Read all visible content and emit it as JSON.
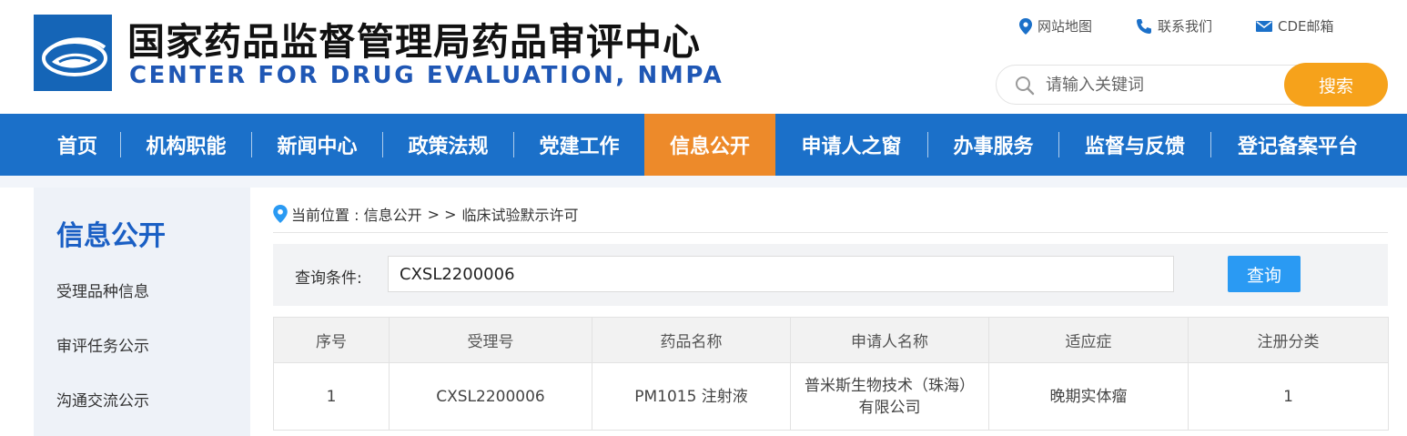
{
  "header": {
    "title_cn": "国家药品监督管理局药品审评中心",
    "title_en": "CENTER FOR DRUG EVALUATION, NMPA",
    "top_links": [
      {
        "label": "网站地图",
        "icon": "location-pin-icon"
      },
      {
        "label": "联系我们",
        "icon": "phone-icon"
      },
      {
        "label": "CDE邮箱",
        "icon": "mail-icon"
      }
    ],
    "search": {
      "placeholder": "请输入关键词",
      "button": "搜索"
    }
  },
  "nav": {
    "items": [
      {
        "label": "首页"
      },
      {
        "label": "机构职能"
      },
      {
        "label": "新闻中心"
      },
      {
        "label": "政策法规"
      },
      {
        "label": "党建工作"
      },
      {
        "label": "信息公开",
        "active": true
      },
      {
        "label": "申请人之窗"
      },
      {
        "label": "办事服务"
      },
      {
        "label": "监督与反馈"
      },
      {
        "label": "登记备案平台"
      }
    ]
  },
  "sidebar": {
    "title": "信息公开",
    "items": [
      {
        "label": "受理品种信息"
      },
      {
        "label": "审评任务公示"
      },
      {
        "label": "沟通交流公示"
      }
    ]
  },
  "breadcrumb": {
    "prefix": "当前位置 : 信息公开",
    "sep": "> >",
    "current": "临床试验默示许可"
  },
  "query": {
    "label": "查询条件:",
    "value": "CXSL2200006",
    "button": "查询"
  },
  "table": {
    "columns": [
      "序号",
      "受理号",
      "药品名称",
      "申请人名称",
      "适应症",
      "注册分类"
    ],
    "rows": [
      [
        "1",
        "CXSL2200006",
        "PM1015 注射液",
        "普米斯生物技术（珠海）有限公司",
        "晚期实体瘤",
        "1"
      ]
    ]
  },
  "colors": {
    "nav_bg": "#1b70c9",
    "nav_active": "#ed8a2a",
    "search_button": "#f6a21b",
    "query_button": "#2a9af3",
    "sidebar_title": "#1a5fc4"
  }
}
